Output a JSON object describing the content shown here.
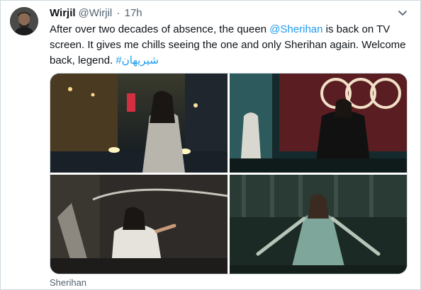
{
  "tweet": {
    "display_name": "Wirjil",
    "handle": "@Wirjil",
    "separator": "·",
    "time": "17h",
    "text_before": "After over two decades of absence, the queen ",
    "mention": "@Sherihan",
    "text_after": " is back on TV screen. It gives me chills seeing the one and only Sherihan again. Welcome back, legend. ",
    "hashtag": "#شيريهان",
    "caption": "Sherihan"
  },
  "icons": {
    "more": "chevron-down-icon"
  },
  "colors": {
    "link": "#1d9bf0",
    "secondary_text": "#536471",
    "primary_text": "#0f1419",
    "border": "#cfd9de"
  }
}
